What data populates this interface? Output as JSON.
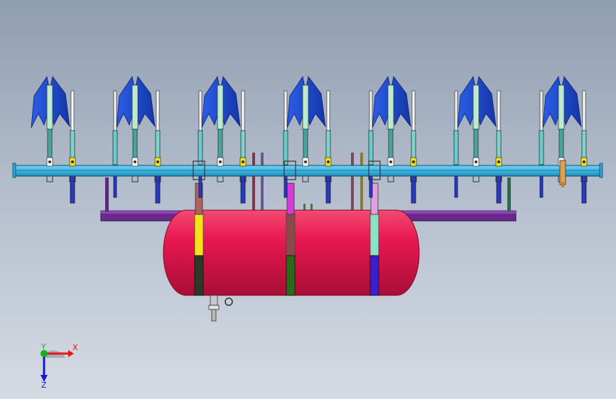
{
  "viewport": {
    "background_top": "#8f9db0",
    "background_bottom": "#d5dbe3"
  },
  "model": {
    "tank_color": "#e8174f",
    "beam_color": "#2ab7e6",
    "plow_blade_color": "#1f4fd6",
    "shank_colors": [
      "#bfe8d0",
      "#7fd4c9",
      "#5fb3b3"
    ],
    "strap_colors": [
      "#f6e11a",
      "#d63bd6",
      "#8fe0c4",
      "#2a6b3a",
      "#3a1fd0",
      "#2a2a2a"
    ],
    "plow_units": 7
  },
  "triad": {
    "x_label": "X",
    "y_label": "Y",
    "z_label": "Z",
    "x_color": "#e01818",
    "y_color": "#18b018",
    "z_color": "#1818d0"
  }
}
